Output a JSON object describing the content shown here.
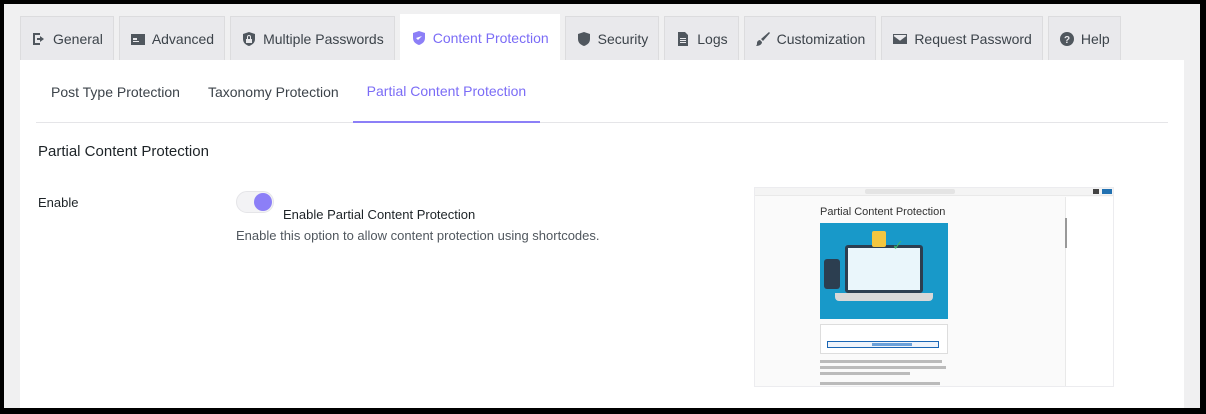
{
  "tabs": [
    {
      "label": "General",
      "icon": "sign-in-icon",
      "active": false
    },
    {
      "label": "Advanced",
      "icon": "admin-generic-icon",
      "active": false
    },
    {
      "label": "Multiple Passwords",
      "icon": "shield-icon",
      "active": false
    },
    {
      "label": "Content Protection",
      "icon": "shield-check-icon",
      "active": true
    },
    {
      "label": "Security",
      "icon": "shield-alt-icon",
      "active": false
    },
    {
      "label": "Logs",
      "icon": "document-icon",
      "active": false
    },
    {
      "label": "Customization",
      "icon": "brush-icon",
      "active": false
    },
    {
      "label": "Request Password",
      "icon": "email-icon",
      "active": false
    },
    {
      "label": "Help",
      "icon": "help-icon",
      "active": false
    }
  ],
  "subtabs": [
    {
      "label": "Post Type Protection",
      "active": false
    },
    {
      "label": "Taxonomy Protection",
      "active": false
    },
    {
      "label": "Partial Content Protection",
      "active": true
    }
  ],
  "section": {
    "title": "Partial Content Protection"
  },
  "field": {
    "label": "Enable",
    "toggle_enabled": true,
    "toggle_label": "Enable Partial Content Protection",
    "description": "Enable this option to allow content protection using shortcodes."
  },
  "preview": {
    "title": "Partial Content Protection"
  },
  "colors": {
    "accent": "#7b6cf6",
    "toggle_knob": "#8c7ff7",
    "panel": "#ffffff",
    "background": "#f0f0f1"
  }
}
